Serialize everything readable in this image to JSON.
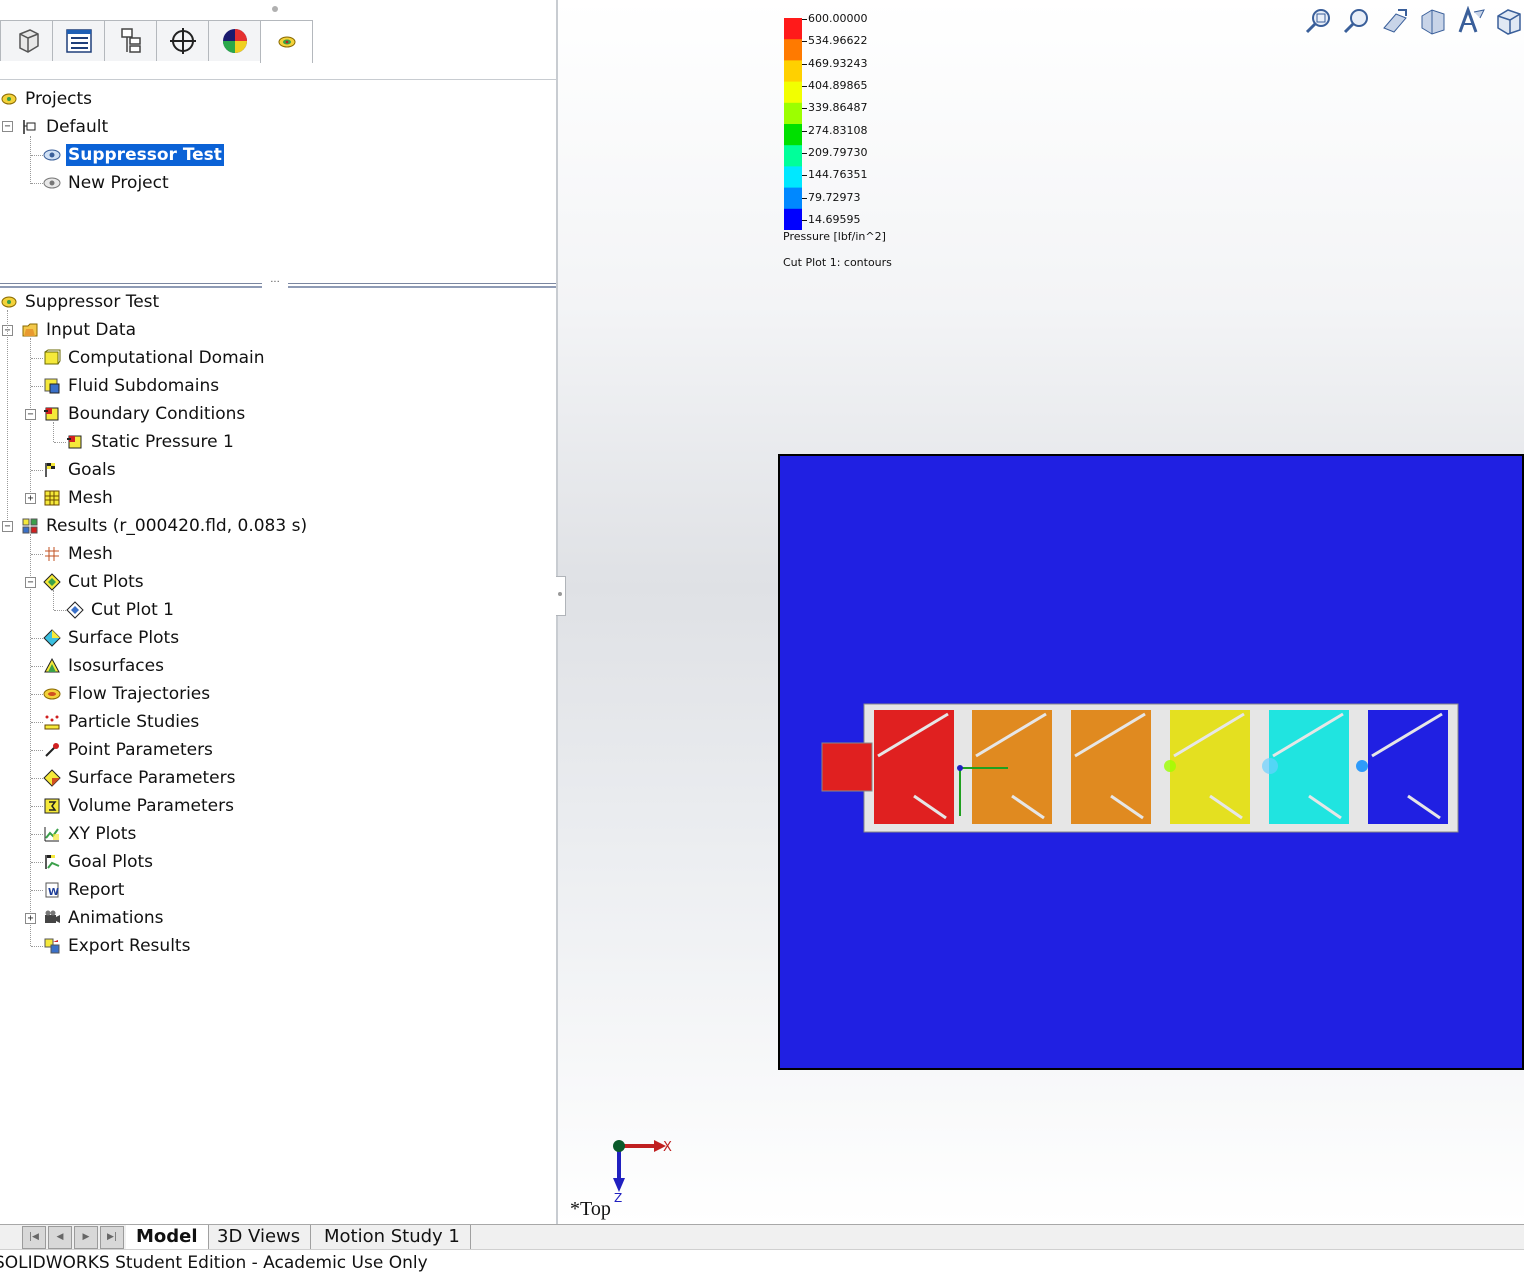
{
  "left_panel": {
    "toolbar_tabs": [
      {
        "name": "feature-manager-tab",
        "icon": "part-icon"
      },
      {
        "name": "property-manager-tab",
        "icon": "list-icon"
      },
      {
        "name": "configuration-manager-tab",
        "icon": "configuration-icon"
      },
      {
        "name": "dimxpert-tab",
        "icon": "crosshair-icon"
      },
      {
        "name": "appearance-tab",
        "icon": "appearance-sphere-icon"
      },
      {
        "name": "flow-simulation-tab",
        "icon": "flow-simulation-icon"
      }
    ],
    "projects_tree": {
      "root": "Projects",
      "default": "Default",
      "items": [
        "Suppressor Test",
        "New Project"
      ]
    },
    "analysis_tree": {
      "root": "Suppressor Test",
      "input_data": {
        "label": "Input Data",
        "children": [
          "Computational Domain",
          "Fluid Subdomains",
          "Boundary Conditions",
          "Goals",
          "Mesh"
        ],
        "boundary_children": [
          "Static Pressure 1"
        ]
      },
      "results": {
        "label": "Results (r_000420.fld, 0.083 s)",
        "children": [
          "Mesh",
          "Cut Plots",
          "Surface Plots",
          "Isosurfaces",
          "Flow Trajectories",
          "Particle Studies",
          "Point Parameters",
          "Surface Parameters",
          "Volume Parameters",
          "XY Plots",
          "Goal Plots",
          "Report",
          "Animations",
          "Export Results"
        ],
        "cut_plot_children": [
          "Cut Plot 1"
        ]
      }
    }
  },
  "viewport": {
    "legend": {
      "values": [
        "600.00000",
        "534.96622",
        "469.93243",
        "404.89865",
        "339.86487",
        "274.83108",
        "209.79730",
        "144.76351",
        "79.72973",
        "14.69595"
      ],
      "colors": [
        "#ff1a1a",
        "#ff7a00",
        "#ffd000",
        "#f2ff00",
        "#9cff00",
        "#00e000",
        "#00ff9a",
        "#00e8ff",
        "#0088ff",
        "#0000ff"
      ],
      "title": "Pressure [lbf/in^2]",
      "subtitle": "Cut Plot 1: contours"
    },
    "plot_colors": {
      "background": "#2020e2",
      "chamber_colors": [
        "#e02020",
        "#e08a20",
        "#e08a20",
        "#e4e020",
        "#20e4e0",
        "#2020e2"
      ],
      "wall": "#e6e6e6"
    },
    "triad_labels": {
      "x": "X",
      "z": "Z"
    },
    "view_orientation": "*Top",
    "heads_up_tools": [
      "zoom-to-fit-icon",
      "zoom-to-area-icon",
      "previous-view-icon",
      "section-view-icon",
      "view-orientation-icon",
      "display-style-icon"
    ]
  },
  "bottom_tabs": [
    "Model",
    "3D Views",
    "Motion Study 1"
  ],
  "status_bar": "SOLIDWORKS Student Edition - Academic Use Only"
}
